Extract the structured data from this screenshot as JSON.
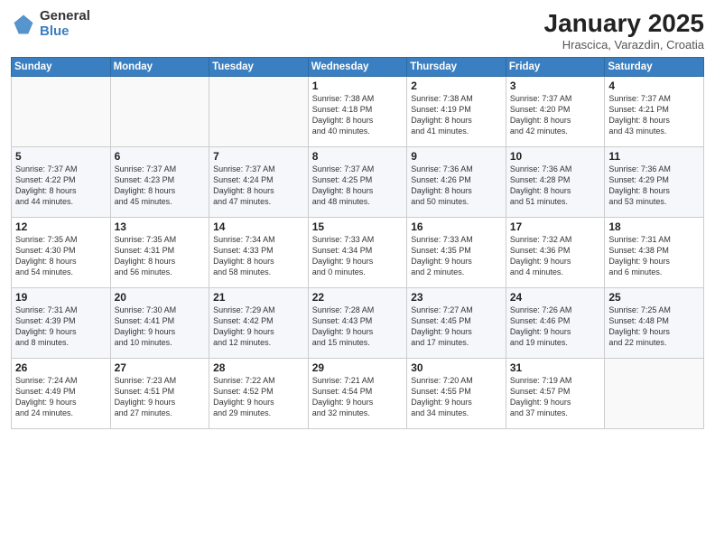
{
  "header": {
    "logo_general": "General",
    "logo_blue": "Blue",
    "month_title": "January 2025",
    "location": "Hrascica, Varazdin, Croatia"
  },
  "weekdays": [
    "Sunday",
    "Monday",
    "Tuesday",
    "Wednesday",
    "Thursday",
    "Friday",
    "Saturday"
  ],
  "weeks": [
    [
      {
        "day": "",
        "info": ""
      },
      {
        "day": "",
        "info": ""
      },
      {
        "day": "",
        "info": ""
      },
      {
        "day": "1",
        "info": "Sunrise: 7:38 AM\nSunset: 4:18 PM\nDaylight: 8 hours\nand 40 minutes."
      },
      {
        "day": "2",
        "info": "Sunrise: 7:38 AM\nSunset: 4:19 PM\nDaylight: 8 hours\nand 41 minutes."
      },
      {
        "day": "3",
        "info": "Sunrise: 7:37 AM\nSunset: 4:20 PM\nDaylight: 8 hours\nand 42 minutes."
      },
      {
        "day": "4",
        "info": "Sunrise: 7:37 AM\nSunset: 4:21 PM\nDaylight: 8 hours\nand 43 minutes."
      }
    ],
    [
      {
        "day": "5",
        "info": "Sunrise: 7:37 AM\nSunset: 4:22 PM\nDaylight: 8 hours\nand 44 minutes."
      },
      {
        "day": "6",
        "info": "Sunrise: 7:37 AM\nSunset: 4:23 PM\nDaylight: 8 hours\nand 45 minutes."
      },
      {
        "day": "7",
        "info": "Sunrise: 7:37 AM\nSunset: 4:24 PM\nDaylight: 8 hours\nand 47 minutes."
      },
      {
        "day": "8",
        "info": "Sunrise: 7:37 AM\nSunset: 4:25 PM\nDaylight: 8 hours\nand 48 minutes."
      },
      {
        "day": "9",
        "info": "Sunrise: 7:36 AM\nSunset: 4:26 PM\nDaylight: 8 hours\nand 50 minutes."
      },
      {
        "day": "10",
        "info": "Sunrise: 7:36 AM\nSunset: 4:28 PM\nDaylight: 8 hours\nand 51 minutes."
      },
      {
        "day": "11",
        "info": "Sunrise: 7:36 AM\nSunset: 4:29 PM\nDaylight: 8 hours\nand 53 minutes."
      }
    ],
    [
      {
        "day": "12",
        "info": "Sunrise: 7:35 AM\nSunset: 4:30 PM\nDaylight: 8 hours\nand 54 minutes."
      },
      {
        "day": "13",
        "info": "Sunrise: 7:35 AM\nSunset: 4:31 PM\nDaylight: 8 hours\nand 56 minutes."
      },
      {
        "day": "14",
        "info": "Sunrise: 7:34 AM\nSunset: 4:33 PM\nDaylight: 8 hours\nand 58 minutes."
      },
      {
        "day": "15",
        "info": "Sunrise: 7:33 AM\nSunset: 4:34 PM\nDaylight: 9 hours\nand 0 minutes."
      },
      {
        "day": "16",
        "info": "Sunrise: 7:33 AM\nSunset: 4:35 PM\nDaylight: 9 hours\nand 2 minutes."
      },
      {
        "day": "17",
        "info": "Sunrise: 7:32 AM\nSunset: 4:36 PM\nDaylight: 9 hours\nand 4 minutes."
      },
      {
        "day": "18",
        "info": "Sunrise: 7:31 AM\nSunset: 4:38 PM\nDaylight: 9 hours\nand 6 minutes."
      }
    ],
    [
      {
        "day": "19",
        "info": "Sunrise: 7:31 AM\nSunset: 4:39 PM\nDaylight: 9 hours\nand 8 minutes."
      },
      {
        "day": "20",
        "info": "Sunrise: 7:30 AM\nSunset: 4:41 PM\nDaylight: 9 hours\nand 10 minutes."
      },
      {
        "day": "21",
        "info": "Sunrise: 7:29 AM\nSunset: 4:42 PM\nDaylight: 9 hours\nand 12 minutes."
      },
      {
        "day": "22",
        "info": "Sunrise: 7:28 AM\nSunset: 4:43 PM\nDaylight: 9 hours\nand 15 minutes."
      },
      {
        "day": "23",
        "info": "Sunrise: 7:27 AM\nSunset: 4:45 PM\nDaylight: 9 hours\nand 17 minutes."
      },
      {
        "day": "24",
        "info": "Sunrise: 7:26 AM\nSunset: 4:46 PM\nDaylight: 9 hours\nand 19 minutes."
      },
      {
        "day": "25",
        "info": "Sunrise: 7:25 AM\nSunset: 4:48 PM\nDaylight: 9 hours\nand 22 minutes."
      }
    ],
    [
      {
        "day": "26",
        "info": "Sunrise: 7:24 AM\nSunset: 4:49 PM\nDaylight: 9 hours\nand 24 minutes."
      },
      {
        "day": "27",
        "info": "Sunrise: 7:23 AM\nSunset: 4:51 PM\nDaylight: 9 hours\nand 27 minutes."
      },
      {
        "day": "28",
        "info": "Sunrise: 7:22 AM\nSunset: 4:52 PM\nDaylight: 9 hours\nand 29 minutes."
      },
      {
        "day": "29",
        "info": "Sunrise: 7:21 AM\nSunset: 4:54 PM\nDaylight: 9 hours\nand 32 minutes."
      },
      {
        "day": "30",
        "info": "Sunrise: 7:20 AM\nSunset: 4:55 PM\nDaylight: 9 hours\nand 34 minutes."
      },
      {
        "day": "31",
        "info": "Sunrise: 7:19 AM\nSunset: 4:57 PM\nDaylight: 9 hours\nand 37 minutes."
      },
      {
        "day": "",
        "info": ""
      }
    ]
  ]
}
